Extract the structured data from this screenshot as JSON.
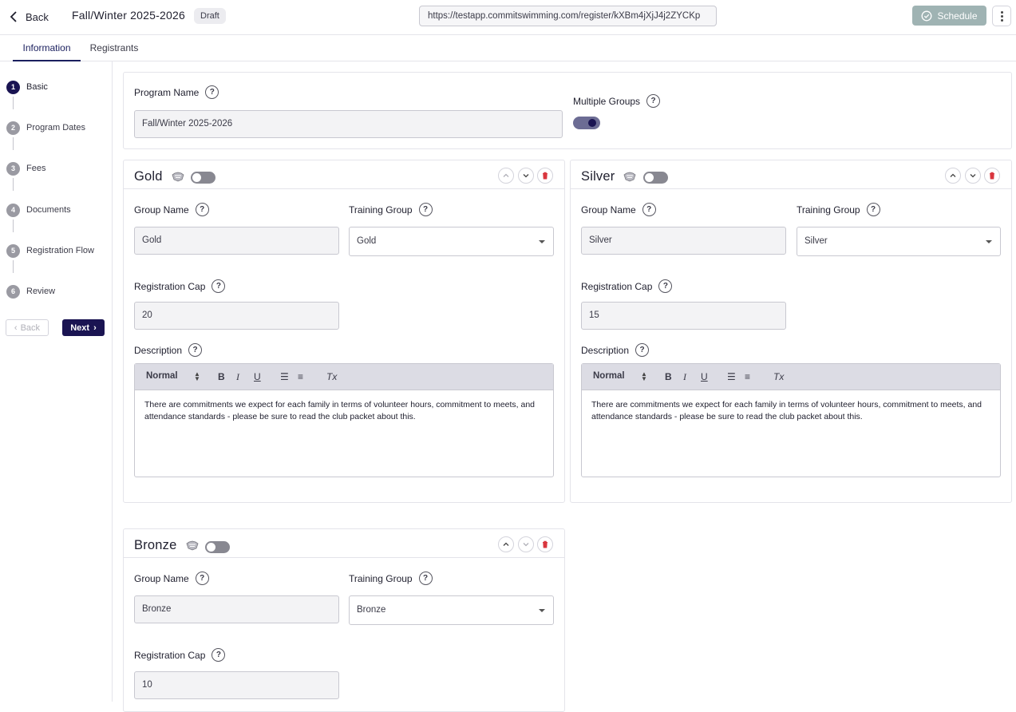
{
  "header": {
    "back_label": "Back",
    "title": "Fall/Winter 2025-2026",
    "status_badge": "Draft",
    "url": "https://testapp.commitswimming.com/register/kXBm4jXjJ4j2ZYCKp",
    "schedule_label": "Schedule"
  },
  "tabs": [
    {
      "label": "Information",
      "active": true
    },
    {
      "label": "Registrants",
      "active": false
    }
  ],
  "steps": [
    {
      "num": "1",
      "label": "Basic",
      "active": true
    },
    {
      "num": "2",
      "label": "Program Dates",
      "active": false
    },
    {
      "num": "3",
      "label": "Fees",
      "active": false
    },
    {
      "num": "4",
      "label": "Documents",
      "active": false
    },
    {
      "num": "5",
      "label": "Registration Flow",
      "active": false
    },
    {
      "num": "6",
      "label": "Review",
      "active": false
    }
  ],
  "stepper_nav": {
    "back_label": "Back",
    "next_label": "Next"
  },
  "program": {
    "name_label": "Program Name",
    "name_value": "Fall/Winter 2025-2026",
    "multiple_groups_label": "Multiple Groups",
    "multiple_groups_on": true
  },
  "labels": {
    "group_name": "Group Name",
    "training_group": "Training Group",
    "registration_cap": "Registration Cap",
    "description": "Description",
    "help": "?"
  },
  "editor_toolbar": {
    "format": "Normal",
    "bold": "B",
    "italic": "I",
    "underline": "U",
    "clear": "Tx"
  },
  "groups": [
    {
      "title": "Gold",
      "group_name": "Gold",
      "training_group": "Gold",
      "registration_cap": "20",
      "description": "There are commitments we expect for each family in terms of volunteer hours, commitment to meets, and attendance standards - please be sure to read the club packet about this."
    },
    {
      "title": "Silver",
      "group_name": "Silver",
      "training_group": "Silver",
      "registration_cap": "15",
      "description": "There are commitments we expect for each family in terms of volunteer hours, commitment to meets, and attendance standards - please be sure to read the club packet about this."
    },
    {
      "title": "Bronze",
      "group_name": "Bronze",
      "training_group": "Bronze",
      "registration_cap": "10",
      "description": ""
    }
  ],
  "colors": {
    "primary": "#1a1452",
    "schedule_disabled": "#9fb3b3",
    "delete": "#d9363e",
    "toolbar_bg": "#dcdce4"
  }
}
